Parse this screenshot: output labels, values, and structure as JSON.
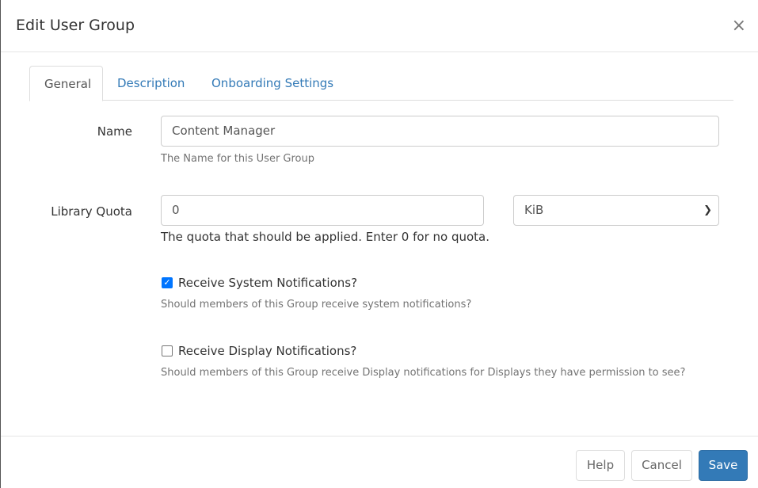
{
  "modal": {
    "title": "Edit User Group",
    "close": "×"
  },
  "tabs": [
    {
      "label": "General"
    },
    {
      "label": "Description"
    },
    {
      "label": "Onboarding Settings"
    }
  ],
  "form": {
    "name": {
      "label": "Name",
      "value": "Content Manager",
      "help": "The Name for this User Group"
    },
    "quota": {
      "label": "Library Quota",
      "value": "0",
      "unit": "KiB",
      "help": "The quota that should be applied. Enter 0 for no quota."
    },
    "system_notifications": {
      "label": "Receive System Notifications?",
      "checked": true,
      "help": "Should members of this Group receive system notifications?"
    },
    "display_notifications": {
      "label": "Receive Display Notifications?",
      "checked": false,
      "help": "Should members of this Group receive Display notifications for Displays they have permission to see?"
    }
  },
  "footer": {
    "help": "Help",
    "cancel": "Cancel",
    "save": "Save"
  }
}
